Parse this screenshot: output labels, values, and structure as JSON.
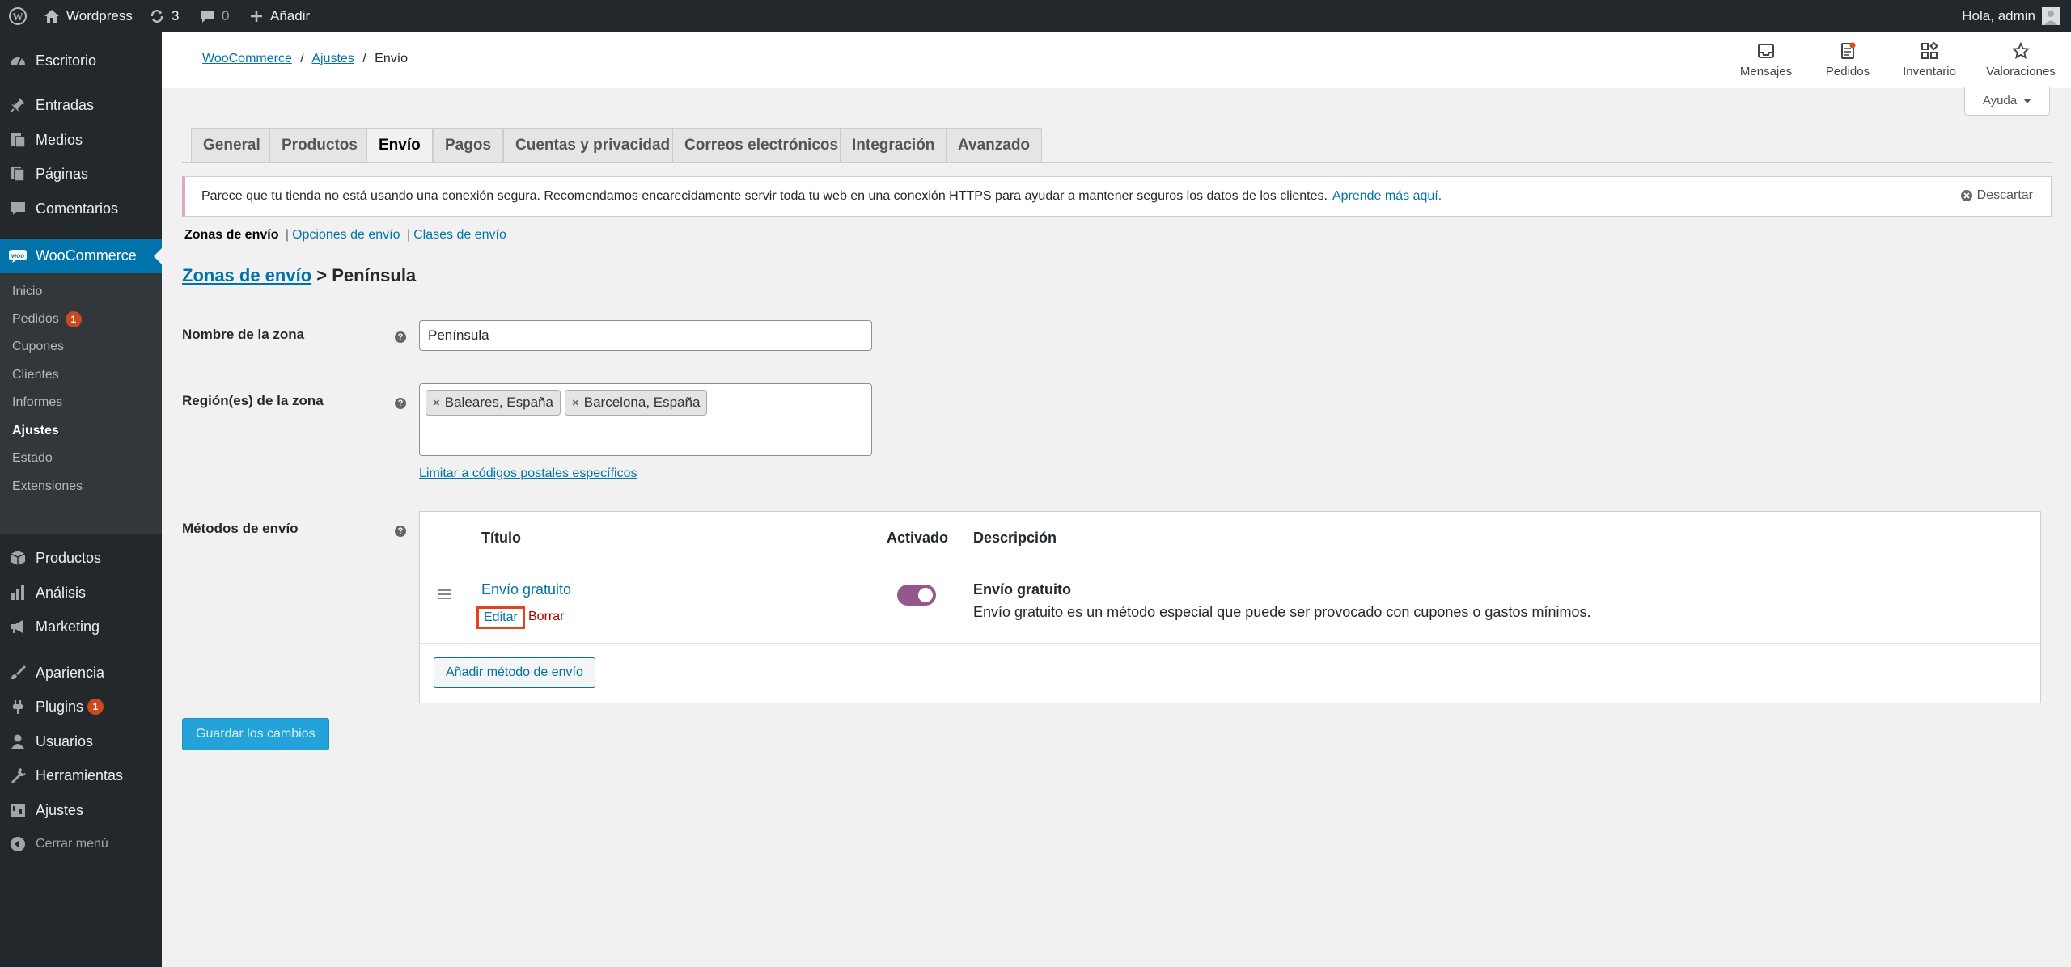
{
  "adminbar": {
    "site_name": "Wordpress",
    "updates_count": "3",
    "comments_count": "0",
    "new_label": "Añadir",
    "greeting": "Hola, admin"
  },
  "sidebar": {
    "items": [
      {
        "label": "Escritorio",
        "icon": "dashboard-icon"
      },
      {
        "label": "Entradas",
        "icon": "pushpin-icon"
      },
      {
        "label": "Medios",
        "icon": "media-icon"
      },
      {
        "label": "Páginas",
        "icon": "pages-icon"
      },
      {
        "label": "Comentarios",
        "icon": "comment-icon"
      },
      {
        "label": "WooCommerce",
        "icon": "woo-icon"
      },
      {
        "label": "Productos",
        "icon": "box-icon"
      },
      {
        "label": "Análisis",
        "icon": "bar-chart-icon"
      },
      {
        "label": "Marketing",
        "icon": "megaphone-icon"
      },
      {
        "label": "Apariencia",
        "icon": "brush-icon"
      },
      {
        "label": "Plugins",
        "icon": "plug-icon",
        "badge": "1"
      },
      {
        "label": "Usuarios",
        "icon": "user-icon"
      },
      {
        "label": "Herramientas",
        "icon": "wrench-icon"
      },
      {
        "label": "Ajustes",
        "icon": "settings-icon"
      },
      {
        "label": "Cerrar menú",
        "icon": "collapse-icon"
      }
    ],
    "submenu": [
      {
        "label": "Inicio"
      },
      {
        "label": "Pedidos",
        "badge": "1"
      },
      {
        "label": "Cupones"
      },
      {
        "label": "Clientes"
      },
      {
        "label": "Informes"
      },
      {
        "label": "Ajustes"
      },
      {
        "label": "Estado"
      },
      {
        "label": "Extensiones"
      }
    ]
  },
  "header": {
    "breadcrumb": {
      "woocommerce": "WooCommerce",
      "sep": "/",
      "ajustes": "Ajustes",
      "current": "Envío"
    },
    "activity": [
      "Mensajes",
      "Pedidos",
      "Inventario",
      "Valoraciones"
    ],
    "help": "Ayuda"
  },
  "tabs": [
    "General",
    "Productos",
    "Envío",
    "Pagos",
    "Cuentas y privacidad",
    "Correos electrónicos",
    "Integración",
    "Avanzado"
  ],
  "notice": {
    "text": "Parece que tu tienda no está usando una conexión segura. Recomendamos encarecidamente servir toda tu web en una conexión HTTPS para ayudar a mantener seguros los datos de los clientes.",
    "link": "Aprende más aquí.",
    "dismiss": "Descartar"
  },
  "subnav": {
    "zones": "Zonas de envío",
    "options": "Opciones de envío",
    "classes": "Clases de envío",
    "sep": "|"
  },
  "zone": {
    "heading_link": "Zonas de envío",
    "heading_rest": "> Península",
    "name_label": "Nombre de la zona",
    "name_value": "Península",
    "regions_label": "Región(es) de la zona",
    "regions": [
      "Baleares, España",
      "Barcelona, España"
    ],
    "limit_link": "Limitar a códigos postales específicos",
    "methods_label": "Métodos de envío"
  },
  "methods": {
    "headers": {
      "title": "Título",
      "enabled": "Activado",
      "description": "Descripción"
    },
    "rows": [
      {
        "title": "Envío gratuito",
        "edit": "Editar",
        "delete": "Borrar",
        "enabled": true,
        "desc_title": "Envío gratuito",
        "desc_text": "Envío gratuito es un método especial que puede ser provocado con cupones o gastos mínimos."
      }
    ],
    "add_button": "Añadir método de envío"
  },
  "save_button": "Guardar los cambios",
  "colors": {
    "accent": "#0073aa",
    "woo_purple": "#96588a",
    "badge": "#ca4a1f",
    "highlight": "#e5431e"
  }
}
